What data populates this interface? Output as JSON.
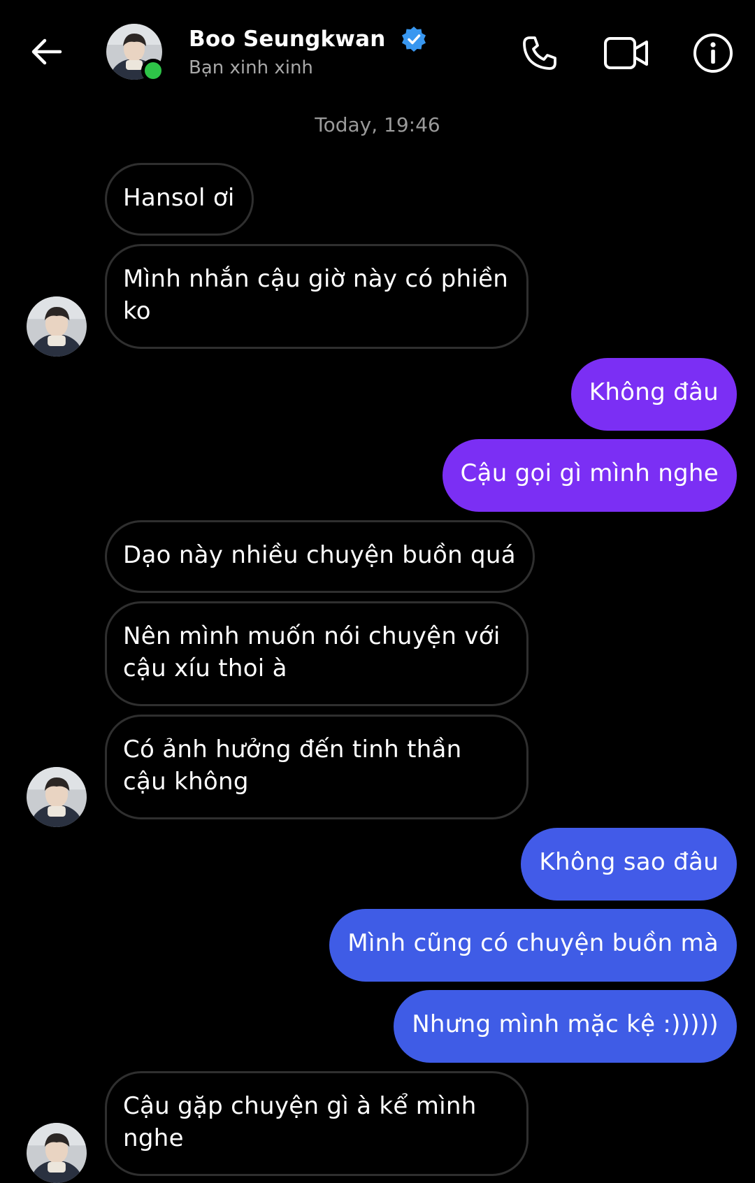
{
  "header": {
    "contact_name": "Boo Seungkwan",
    "contact_status": "Bạn xinh xinh",
    "verified": true,
    "online": true,
    "icons": {
      "back": "arrow-left-icon",
      "call": "phone-icon",
      "video": "video-camera-icon",
      "info": "info-icon",
      "verified": "verified-badge-icon"
    }
  },
  "timestamp": "Today, 19:46",
  "messages": [
    {
      "from": "contact",
      "text": "Hansol ơi"
    },
    {
      "from": "contact",
      "text": "Mình nhắn cậu giờ này có phiền ko"
    },
    {
      "from": "me",
      "text": "Không đâu"
    },
    {
      "from": "me",
      "text": "Cậu gọi gì mình nghe"
    },
    {
      "from": "contact",
      "text": "Dạo này nhiều chuyện buồn quá"
    },
    {
      "from": "contact",
      "text": "Nên mình muốn nói chuyện với cậu xíu thoi à"
    },
    {
      "from": "contact",
      "text": "Có ảnh hưởng đến tinh thần cậu không"
    },
    {
      "from": "me",
      "text": "Không sao đâu"
    },
    {
      "from": "me",
      "text": "Mình cũng có chuyện buồn mà"
    },
    {
      "from": "me",
      "text": "Nhưng mình mặc kệ :)))))"
    },
    {
      "from": "contact",
      "text": "Cậu gặp chuyện gì à kể mình nghe"
    }
  ],
  "colors": {
    "background": "#000000",
    "outgoing_purple": "#7b2ff4",
    "outgoing_blue": "#3f5ce6",
    "incoming_border": "#2f2f2f",
    "online_dot": "#2ec448",
    "verified_blue": "#3897f0",
    "muted_text": "#a8a8a8"
  }
}
